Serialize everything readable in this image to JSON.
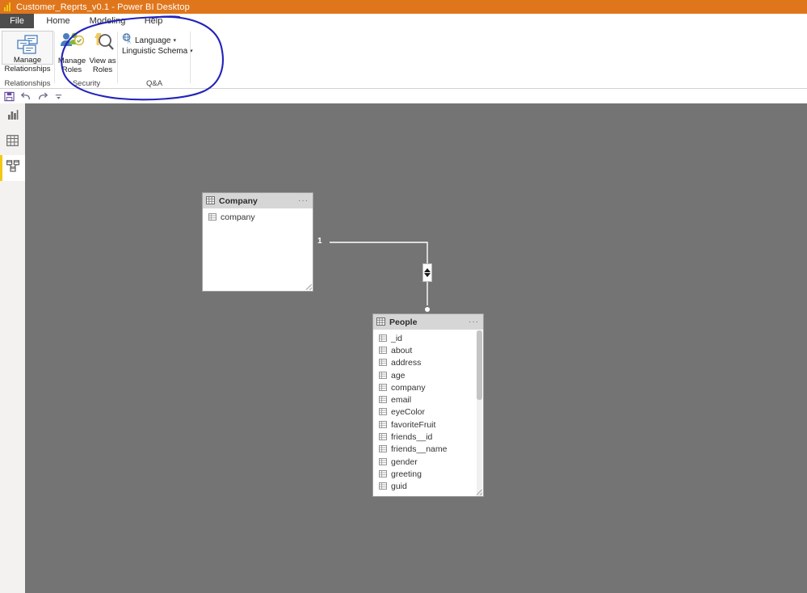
{
  "window": {
    "title": "Customer_Reprts_v0.1 - Power BI Desktop",
    "logo_icon": "power-bi-logo-icon",
    "titlebar_color": "#e0761b"
  },
  "ribbon": {
    "tabs": [
      {
        "label": "File",
        "selected": false
      },
      {
        "label": "Home",
        "selected": false
      },
      {
        "label": "Modeling",
        "selected": true
      },
      {
        "label": "Help",
        "selected": false
      }
    ],
    "groups": [
      {
        "label": "Relationships",
        "buttons": [
          {
            "label": "Manage Relationships",
            "icon": "manage-relationships-icon"
          }
        ]
      },
      {
        "label": "Security",
        "buttons": [
          {
            "label": "Manage Roles",
            "icon": "manage-roles-icon"
          },
          {
            "label": "View as Roles",
            "icon": "view-as-roles-icon"
          }
        ]
      },
      {
        "label": "Q&A",
        "buttons": [
          {
            "label": "Language",
            "icon": "language-globe-icon",
            "caret": "▾"
          },
          {
            "label": "Linguistic Schema",
            "icon": "linguistic-schema-icon",
            "caret": "▾"
          }
        ]
      }
    ]
  },
  "quick_access": {
    "items": [
      {
        "name": "save",
        "icon": "save-floppy-icon"
      },
      {
        "name": "undo",
        "icon": "undo-arrow-icon"
      },
      {
        "name": "redo",
        "icon": "redo-arrow-icon"
      },
      {
        "name": "customize",
        "icon": "chevron-down-icon"
      }
    ]
  },
  "view_rail": {
    "items": [
      {
        "name": "report-view",
        "icon": "report-chart-icon",
        "selected": false
      },
      {
        "name": "data-view",
        "icon": "data-table-icon",
        "selected": false
      },
      {
        "name": "model-view",
        "icon": "model-relationships-icon",
        "selected": true
      }
    ],
    "selected_accent": "#f2c811"
  },
  "canvas": {
    "background": "#747474",
    "tables": [
      {
        "name": "Company",
        "icon": "table-icon",
        "menu": "···",
        "fields": [
          {
            "name": "company",
            "icon": "column-field-icon"
          }
        ],
        "has_scrollbar": false
      },
      {
        "name": "People",
        "icon": "table-icon",
        "menu": "···",
        "fields": [
          {
            "name": "_id",
            "icon": "column-field-icon"
          },
          {
            "name": "about",
            "icon": "column-field-icon"
          },
          {
            "name": "address",
            "icon": "column-field-icon"
          },
          {
            "name": "age",
            "icon": "column-field-icon"
          },
          {
            "name": "company",
            "icon": "column-field-icon"
          },
          {
            "name": "email",
            "icon": "column-field-icon"
          },
          {
            "name": "eyeColor",
            "icon": "column-field-icon"
          },
          {
            "name": "favoriteFruit",
            "icon": "column-field-icon"
          },
          {
            "name": "friends__id",
            "icon": "column-field-icon"
          },
          {
            "name": "friends__name",
            "icon": "column-field-icon"
          },
          {
            "name": "gender",
            "icon": "column-field-icon"
          },
          {
            "name": "greeting",
            "icon": "column-field-icon"
          },
          {
            "name": "guid",
            "icon": "column-field-icon"
          }
        ],
        "has_scrollbar": true
      }
    ],
    "relationship": {
      "from_table": "Company",
      "to_table": "People",
      "from_cardinality": "1",
      "to_cardinality": "*",
      "cross_filter": "both",
      "cross_filter_icon": "bidirectional-arrows-icon"
    }
  },
  "annotation": {
    "type": "hand-drawn-ellipse",
    "color": "#2222bb",
    "encircles": "Security and Q&A ribbon groups"
  }
}
